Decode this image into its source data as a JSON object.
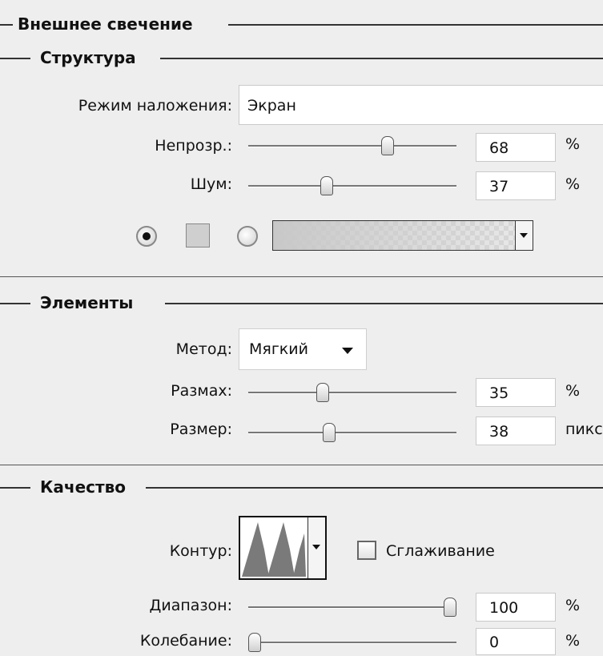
{
  "panel": {
    "title": "Внешнее свечение"
  },
  "structure": {
    "title": "Структура",
    "blend_mode_label": "Режим наложения:",
    "blend_mode_value": "Экран",
    "opacity_label": "Непрозр.:",
    "opacity_value": "68",
    "opacity_unit": "%",
    "opacity_level": 68,
    "noise_label": "Шум:",
    "noise_value": "37",
    "noise_unit": "%",
    "noise_level": 37,
    "color_mode": "solid",
    "swatch_color": "#cfcfcf"
  },
  "elements": {
    "title": "Элементы",
    "method_label": "Метод:",
    "method_value": "Мягкий",
    "spread_label": "Размах:",
    "spread_value": "35",
    "spread_unit": "%",
    "spread_level": 35,
    "size_label": "Размер:",
    "size_value": "38",
    "size_unit": "пикс",
    "size_level": 38
  },
  "quality": {
    "title": "Качество",
    "contour_label": "Контур:",
    "antialias_label": "Сглаживание",
    "antialias_checked": false,
    "range_label": "Диапазон:",
    "range_value": "100",
    "range_unit": "%",
    "range_level": 100,
    "jitter_label": "Колебание:",
    "jitter_value": "0",
    "jitter_unit": "%",
    "jitter_level": 0
  }
}
